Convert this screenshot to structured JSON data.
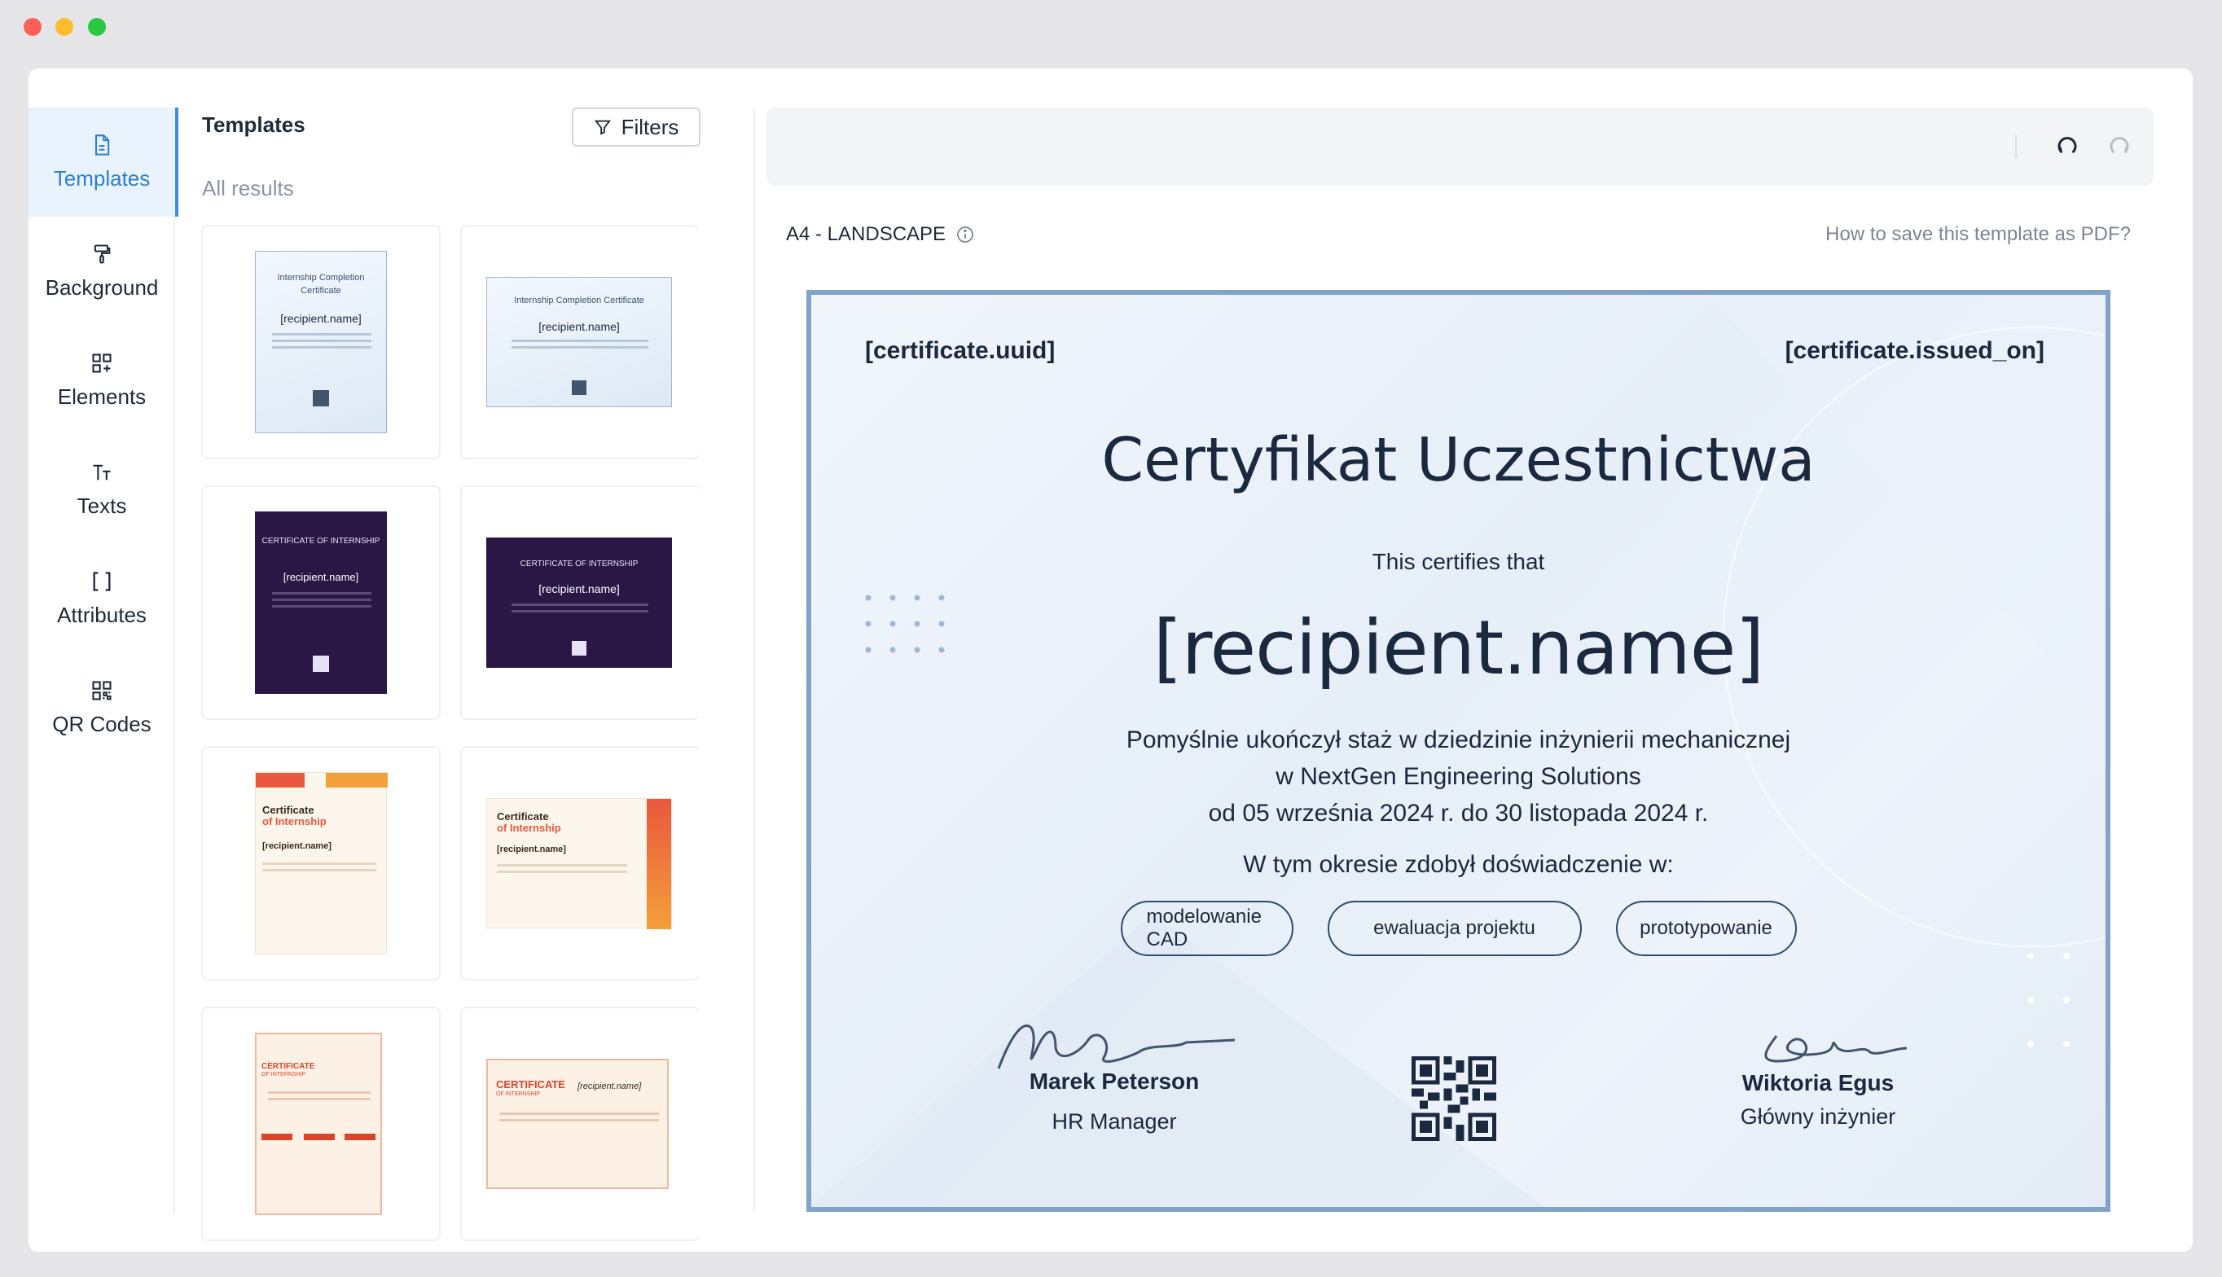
{
  "rail": {
    "items": [
      {
        "label": "Templates",
        "icon": "file-icon",
        "active": true
      },
      {
        "label": "Background",
        "icon": "paint-roller-icon"
      },
      {
        "label": "Elements",
        "icon": "elements-grid-icon"
      },
      {
        "label": "Texts",
        "icon": "text-icon"
      },
      {
        "label": "Attributes",
        "icon": "brackets-icon"
      },
      {
        "label": "QR Codes",
        "icon": "qr-code-icon"
      }
    ]
  },
  "panel": {
    "title": "Templates",
    "filters_label": "Filters",
    "results_label": "All results"
  },
  "canvas": {
    "format_label": "A4 - LANDSCAPE",
    "help_link": "How to save this template as PDF?"
  },
  "certificate": {
    "uuid": "[certificate.uuid]",
    "issued_on": "[certificate.issued_on]",
    "title": "Certyfikat Uczestnictwa",
    "certifies": "This certifies that",
    "recipient": "[recipient.name]",
    "line1": "Pomyślnie ukończył staż w dziedzinie inżynierii mechanicznej",
    "line2": "w NextGen Engineering Solutions",
    "line3": "od 05 września 2024 r. do 30 listopada 2024 r.",
    "experience": "W tym okresie zdobył doświadczenie w:",
    "skills": [
      "modelowanie CAD",
      "ewaluacja projektu",
      "prototypowanie"
    ],
    "signer1": {
      "name": "Marek Peterson",
      "role": "HR Manager"
    },
    "signer2": {
      "name": "Wiktoria Egus",
      "role": "Główny inżynier"
    }
  },
  "thumbnails": {
    "recipient_placeholder": "[recipient.name]",
    "internship_title": "Internship Completion Certificate",
    "internship_title_line1": "Internship Completion",
    "internship_title_line2": "Certificate",
    "dark_title": "CERTIFICATE OF INTERNSHIP",
    "warm_title1": "Certificate",
    "warm_title2": "of Internship",
    "red_title1": "CERTIFICATE",
    "red_title2": "OF INTERNSHIP"
  },
  "colors": {
    "accent": "#3d8fdc",
    "cert_border": "#7fa3c9",
    "text_dark": "#1a2940"
  }
}
